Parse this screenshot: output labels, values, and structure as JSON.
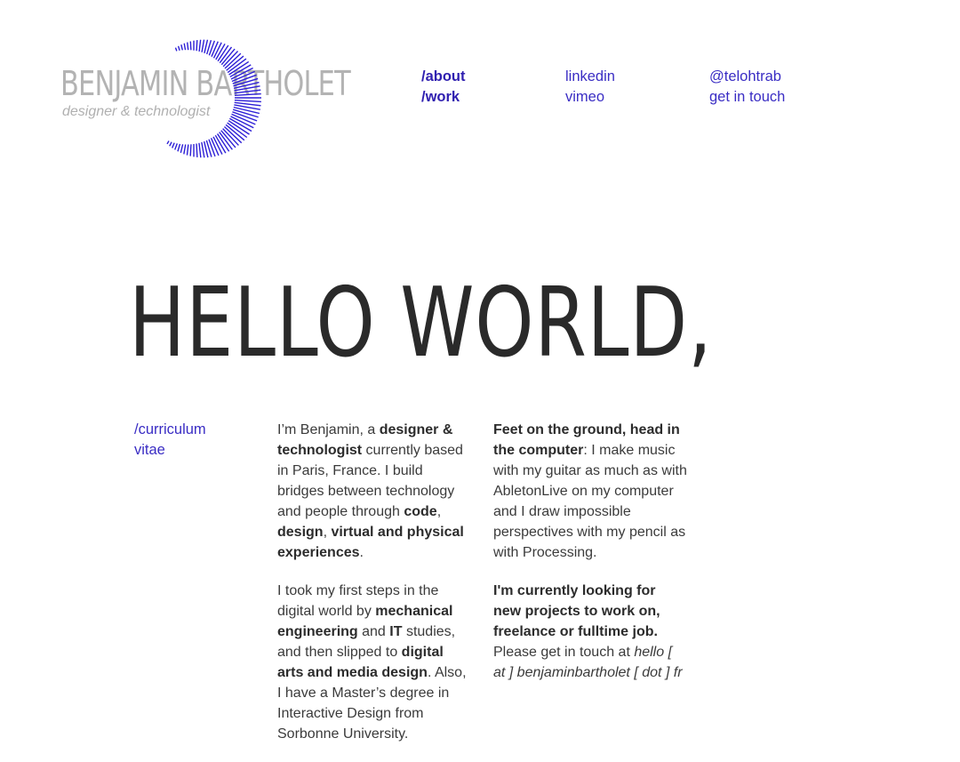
{
  "logo": {
    "name": "BENJAMIN BARTHOLET",
    "tagline": "designer & technologist",
    "accent_color": "#2d1fd6",
    "mark_icon": "radial-burst-arc-icon"
  },
  "nav": {
    "about": "/about",
    "work": "/work",
    "linkedin": "linkedin",
    "vimeo": "vimeo",
    "twitter": "@telohtrab",
    "contact": "get in touch"
  },
  "hero": {
    "title": "HELLO WORLD,"
  },
  "cv": {
    "line1": "/curriculum",
    "line2": "vitae"
  },
  "bio": {
    "p1": [
      {
        "t": "I’m Benjamin, a ",
        "s": "normal"
      },
      {
        "t": "designer & technologist",
        "s": "bold"
      },
      {
        "t": " currently based in Paris, France. I build bridges between technology and people through ",
        "s": "normal"
      },
      {
        "t": "code",
        "s": "bold"
      },
      {
        "t": ", ",
        "s": "normal"
      },
      {
        "t": "design",
        "s": "bold"
      },
      {
        "t": ", ",
        "s": "normal"
      },
      {
        "t": "virtual and physical experiences",
        "s": "bold"
      },
      {
        "t": ".",
        "s": "normal"
      }
    ],
    "p2": [
      {
        "t": "I took my first steps in the digital world by ",
        "s": "normal"
      },
      {
        "t": "mechanical engineering",
        "s": "bold"
      },
      {
        "t": " and ",
        "s": "normal"
      },
      {
        "t": "IT",
        "s": "bold"
      },
      {
        "t": " studies, and then slipped to ",
        "s": "normal"
      },
      {
        "t": "digital arts and media design",
        "s": "bold"
      },
      {
        "t": ". Also, I have a Master’s degree in Interactive Design from Sorbonne University.",
        "s": "normal"
      }
    ],
    "p3": [
      {
        "t": "Feet on the ground, head in the computer",
        "s": "bold"
      },
      {
        "t": ": I make music with my guitar as much as with AbletonLive on my computer and I draw impossible perspectives with my pencil as with Processing.",
        "s": "normal"
      }
    ],
    "p4": [
      {
        "t": "I'm currently looking for new projects to work on, freelance or fulltime job.",
        "s": "bold"
      },
      {
        "t": " Please get in touch at ",
        "s": "normal"
      },
      {
        "t": "hello [ at ] benjaminbartholet [ dot ] fr",
        "s": "italic"
      }
    ]
  }
}
